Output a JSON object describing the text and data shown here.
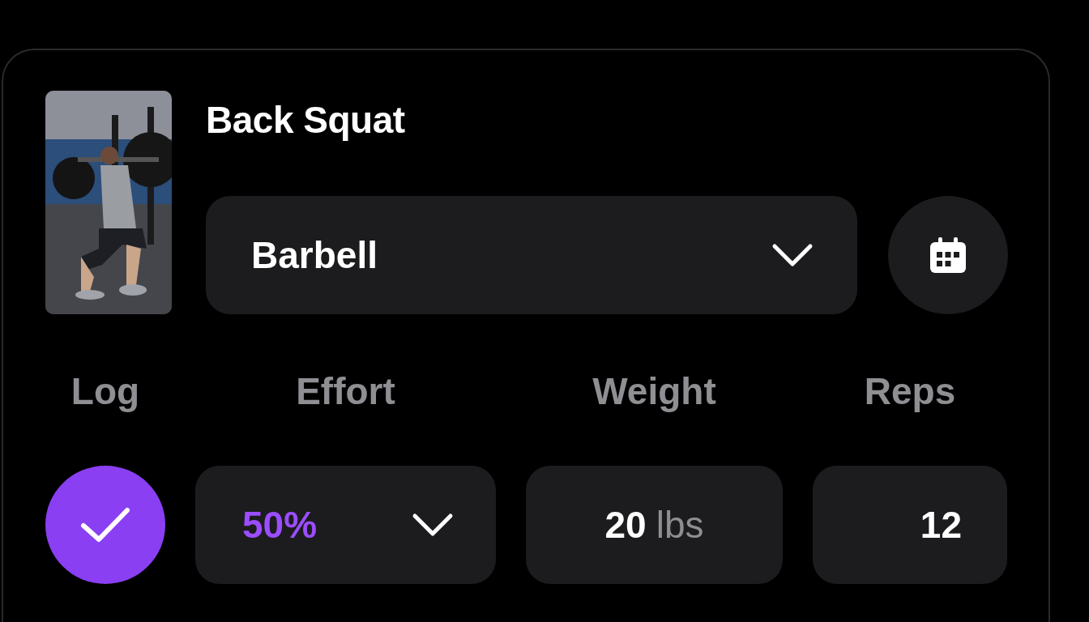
{
  "exercise": {
    "title": "Back Squat",
    "equipment": {
      "value": "Barbell"
    }
  },
  "columns": [
    "Log",
    "Effort",
    "Weight",
    "Reps"
  ],
  "sets": [
    {
      "logged": true,
      "effort": "50%",
      "weight": "20",
      "unit": "lbs",
      "reps": "12"
    }
  ]
}
